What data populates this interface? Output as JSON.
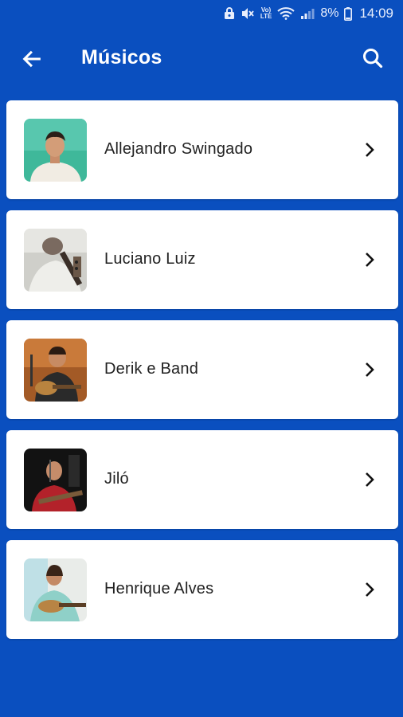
{
  "status_bar": {
    "volte_label": "Vo)\nLTE",
    "battery_percent": "8%",
    "time": "14:09"
  },
  "app_bar": {
    "title": "Músicos",
    "back_icon": "arrow-left-icon",
    "search_icon": "search-icon"
  },
  "colors": {
    "background": "#0a4fbf",
    "card": "#ffffff",
    "text": "#222222"
  },
  "musicians": [
    {
      "name": "Allejandro Swingado"
    },
    {
      "name": "Luciano Luiz"
    },
    {
      "name": "Derik e Band"
    },
    {
      "name": "Jiló"
    },
    {
      "name": "Henrique Alves"
    }
  ]
}
